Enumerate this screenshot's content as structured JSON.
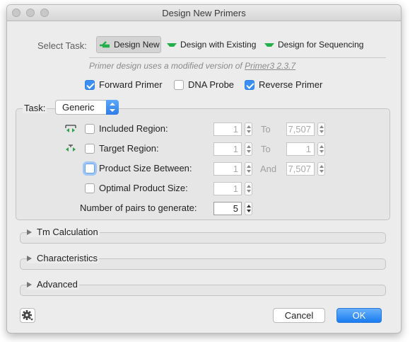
{
  "window": {
    "title": "Design New Primers"
  },
  "task_select": {
    "label": "Select Task:",
    "options": [
      "Design New",
      "Design with Existing",
      "Design for Sequencing"
    ],
    "selected": "Design New"
  },
  "info": {
    "prefix": "Primer design uses a modified version of ",
    "link": "Primer3 2.3.7"
  },
  "primer_types": [
    {
      "label": "Forward Primer",
      "checked": true
    },
    {
      "label": "DNA Probe",
      "checked": false
    },
    {
      "label": "Reverse Primer",
      "checked": true
    }
  ],
  "task": {
    "label": "Task:",
    "value": "Generic"
  },
  "rows": {
    "included": {
      "label": "Included Region:",
      "from": "1",
      "sep": "To",
      "to": "7,507"
    },
    "target": {
      "label": "Target Region:",
      "from": "1",
      "sep": "To",
      "to": "1"
    },
    "product": {
      "label": "Product Size Between:",
      "from": "1",
      "sep": "And",
      "to": "7,507"
    },
    "optimal": {
      "label": "Optimal Product Size:",
      "value": "1"
    },
    "pairs": {
      "label": "Number of pairs to generate:",
      "value": "5"
    }
  },
  "sections": [
    "Tm Calculation",
    "Characteristics",
    "Advanced"
  ],
  "buttons": {
    "cancel": "Cancel",
    "ok": "OK"
  },
  "colors": {
    "accent": "#3b8ff4",
    "primer_green": "#23b04a",
    "region_green": "#2aa14a"
  },
  "icons": [
    "settings-gear-icon"
  ]
}
